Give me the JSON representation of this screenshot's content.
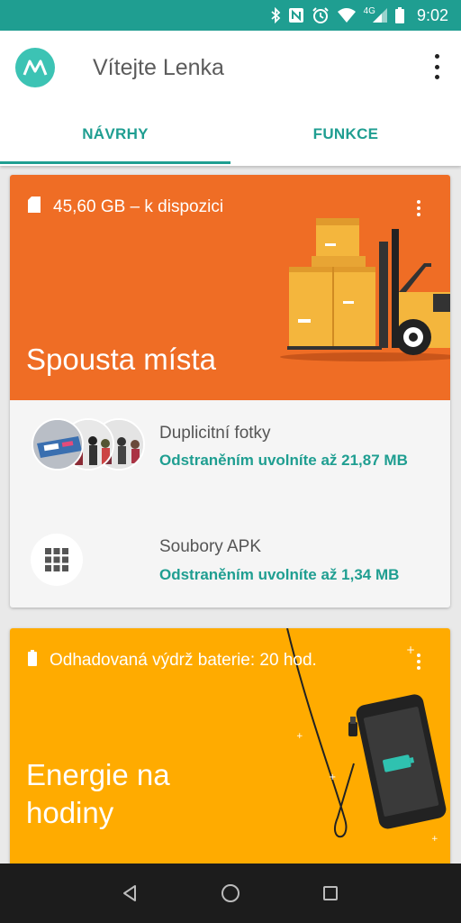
{
  "status_bar": {
    "time": "9:02",
    "network": "4G",
    "icons": [
      "bluetooth-icon",
      "nfc-icon",
      "alarm-icon",
      "wifi-icon",
      "cell-signal-icon",
      "battery-icon"
    ]
  },
  "app_bar": {
    "title": "Vítejte Lenka",
    "logo": "motorola-logo-icon",
    "menu_icon": "overflow-menu-icon"
  },
  "tabs": [
    {
      "label": "NÁVRHY",
      "active": true
    },
    {
      "label": "FUNKCE",
      "active": false
    }
  ],
  "storage_card": {
    "subtitle": "45,60 GB – k dispozici",
    "subtitle_icon": "sd-card-icon",
    "title": "Spousta místa",
    "color": "#ef6d25",
    "items": [
      {
        "title": "Duplicitní fotky",
        "detail": "Odstraněním uvolníte až 21,87 MB",
        "icon": "photo-thumbnails"
      },
      {
        "title": "Soubory APK",
        "detail": "Odstraněním uvolníte až 1,34 MB",
        "icon": "apps-grid-icon"
      }
    ]
  },
  "battery_card": {
    "subtitle": "Odhadovaná výdrž baterie: 20 hod.",
    "subtitle_icon": "battery-icon",
    "title_line1": "Energie na",
    "title_line2": "hodiny",
    "color": "#ffab00"
  },
  "colors": {
    "accent": "#1f9e91",
    "status_bar": "#1f9e91",
    "nav_bar": "#1c1c1c"
  },
  "nav_bar": {
    "back": "back-icon",
    "home": "home-icon",
    "recents": "recents-icon"
  }
}
